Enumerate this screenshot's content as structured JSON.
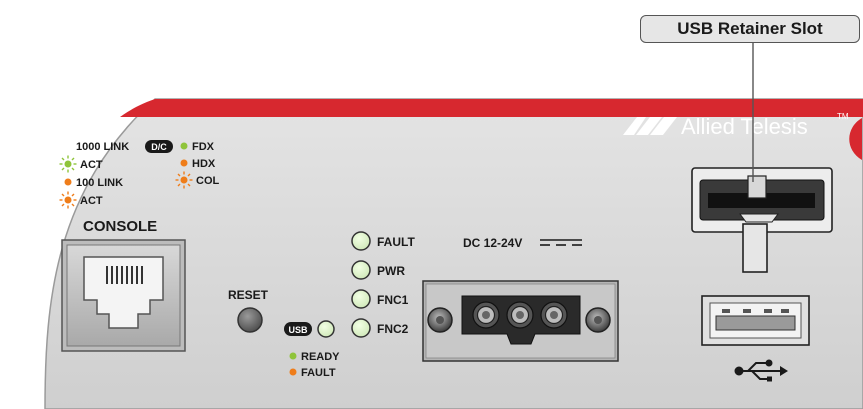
{
  "callout": {
    "label": "USB Retainer Slot"
  },
  "brand": {
    "name": "Allied Telesis",
    "trademark": "TM"
  },
  "port_legend": {
    "link_1000": "1000 LINK",
    "act_1": "ACT",
    "link_100": "100 LINK",
    "act_2": "ACT",
    "dc_badge": "D/C",
    "fdx": "FDX",
    "hdx": "HDX",
    "col": "COL"
  },
  "console": {
    "label": "CONSOLE"
  },
  "reset": {
    "label": "RESET"
  },
  "usb_status": {
    "badge": "USB",
    "ready": "READY",
    "fault": "FAULT"
  },
  "leds": {
    "fault": "FAULT",
    "pwr": "PWR",
    "fnc1": "FNC1",
    "fnc2": "FNC2"
  },
  "power": {
    "label": "DC 12-24V"
  },
  "colors": {
    "brand_red": "#d7282f",
    "panel_gray": "#dcdcdc",
    "led_green": "#8fc43a",
    "led_orange": "#ef7d1a"
  }
}
